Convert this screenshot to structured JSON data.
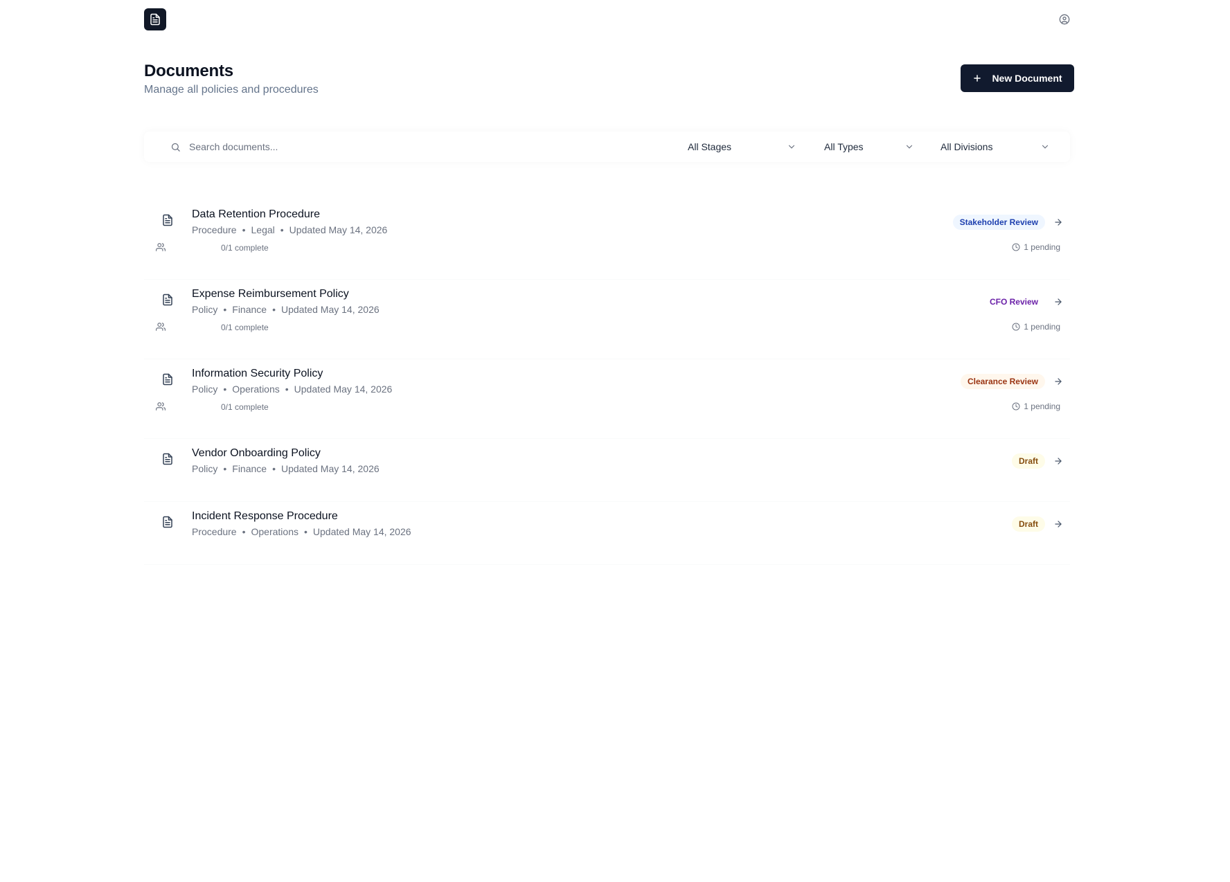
{
  "header": {
    "title": "Documents",
    "subtitle": "Manage all policies and procedures",
    "new_button_label": "New Document"
  },
  "filters": {
    "search_placeholder": "Search documents...",
    "search_value": "",
    "stage": "All Stages",
    "type": "All Types",
    "division": "All Divisions"
  },
  "documents": [
    {
      "title": "Data Retention Procedure",
      "type": "Procedure",
      "division": "Legal",
      "updated": "Updated May 14, 2026",
      "status": "Stakeholder Review",
      "status_color": "#1e40af",
      "progress": "0/1 complete",
      "pending": "1 pending"
    },
    {
      "title": "Expense Reimbursement Policy",
      "type": "Policy",
      "division": "Finance",
      "updated": "Updated May 14, 2026",
      "status": "CFO Review",
      "status_color": "#6b21a8",
      "progress": "0/1 complete",
      "pending": "1 pending"
    },
    {
      "title": "Information Security Policy",
      "type": "Policy",
      "division": "Operations",
      "updated": "Updated May 14, 2026",
      "status": "Clearance Review",
      "status_color": "#9a3412",
      "progress": "0/1 complete",
      "pending": "1 pending"
    },
    {
      "title": "Vendor Onboarding Policy",
      "type": "Policy",
      "division": "Finance",
      "updated": "Updated May 14, 2026",
      "status": "Draft",
      "status_color": "#854d0e"
    },
    {
      "title": "Incident Response Procedure",
      "type": "Procedure",
      "division": "Operations",
      "updated": "Updated May 14, 2026",
      "status": "Draft",
      "status_color": "#854d0e"
    }
  ],
  "icons": {
    "logo": "document-icon",
    "account": "user-circle-icon",
    "search": "search-icon",
    "chevron": "chevron-down-icon",
    "document": "file-text-icon",
    "people": "users-icon",
    "arrow": "arrow-right-icon",
    "clock": "clock-icon"
  }
}
